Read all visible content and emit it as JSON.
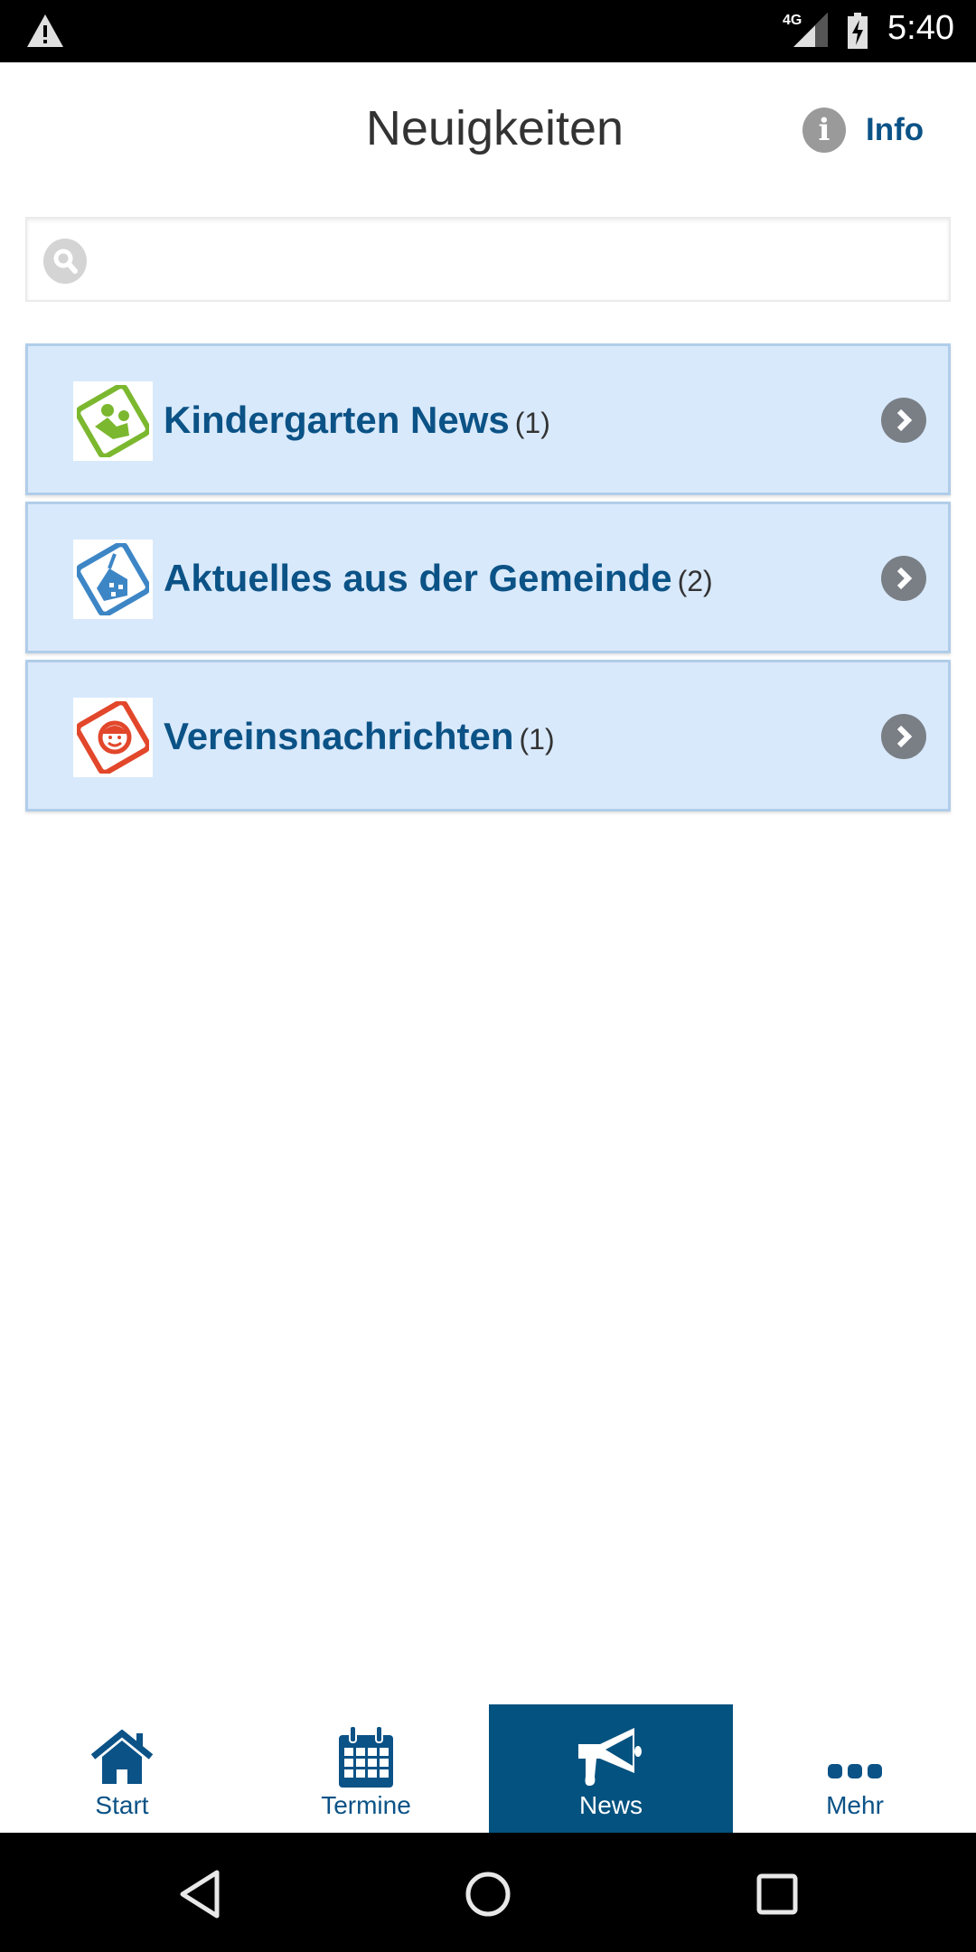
{
  "status_bar": {
    "network": "4G",
    "time": "5:40",
    "icons": [
      "warning-icon",
      "signal-icon",
      "battery-charging-icon"
    ]
  },
  "header": {
    "title": "Neuigkeiten",
    "info_label": "Info",
    "info_icon": "info-icon"
  },
  "search": {
    "placeholder": "",
    "value": "",
    "icon": "search-icon"
  },
  "categories": [
    {
      "label": "Kindergarten News",
      "count": "(1)",
      "icon": "kindergarten-icon",
      "color": "#7cb82f"
    },
    {
      "label": "Aktuelles aus der Gemeinde",
      "count": "(2)",
      "icon": "municipality-icon",
      "color": "#3d86c6"
    },
    {
      "label": "Vereinsnachrichten",
      "count": "(1)",
      "icon": "club-icon",
      "color": "#e2472b"
    }
  ],
  "tabs": [
    {
      "label": "Start",
      "icon": "home-icon",
      "active": false
    },
    {
      "label": "Termine",
      "icon": "calendar-icon",
      "active": false
    },
    {
      "label": "News",
      "icon": "megaphone-icon",
      "active": true
    },
    {
      "label": "Mehr",
      "icon": "more-icon",
      "active": false
    }
  ],
  "colors": {
    "brand": "#04527f",
    "item_bg": "#d8e9fb",
    "item_border": "#b0cde9"
  }
}
